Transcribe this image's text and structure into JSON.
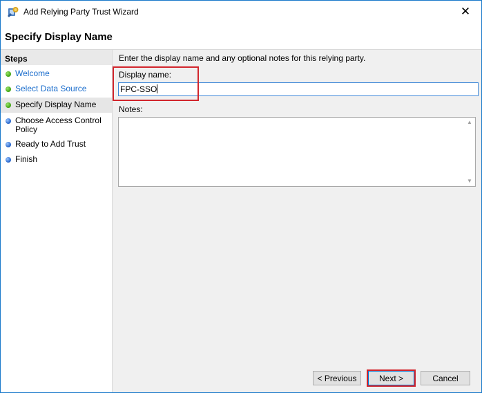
{
  "window": {
    "title": "Add Relying Party Trust Wizard",
    "close_glyph": "✕"
  },
  "header": {
    "title": "Specify Display Name"
  },
  "steps": {
    "heading": "Steps",
    "items": [
      {
        "label": "Welcome",
        "status": "done",
        "color": "#3da10f"
      },
      {
        "label": "Select Data Source",
        "status": "done",
        "color": "#3da10f"
      },
      {
        "label": "Specify Display Name",
        "status": "current",
        "color": "#3da10f"
      },
      {
        "label": "Choose Access Control Policy",
        "status": "pending",
        "color": "#2060c8"
      },
      {
        "label": "Ready to Add Trust",
        "status": "pending",
        "color": "#2060c8"
      },
      {
        "label": "Finish",
        "status": "pending",
        "color": "#2060c8"
      }
    ]
  },
  "main": {
    "instruction": "Enter the display name and any optional notes for this relying party.",
    "display_name_label": "Display name:",
    "display_name_value": "FPC-SSO",
    "notes_label": "Notes:",
    "notes_value": ""
  },
  "footer": {
    "previous_label": "< Previous",
    "next_label": "Next >",
    "cancel_label": "Cancel"
  },
  "annotation": {
    "highlight_color": "#d2252c"
  }
}
